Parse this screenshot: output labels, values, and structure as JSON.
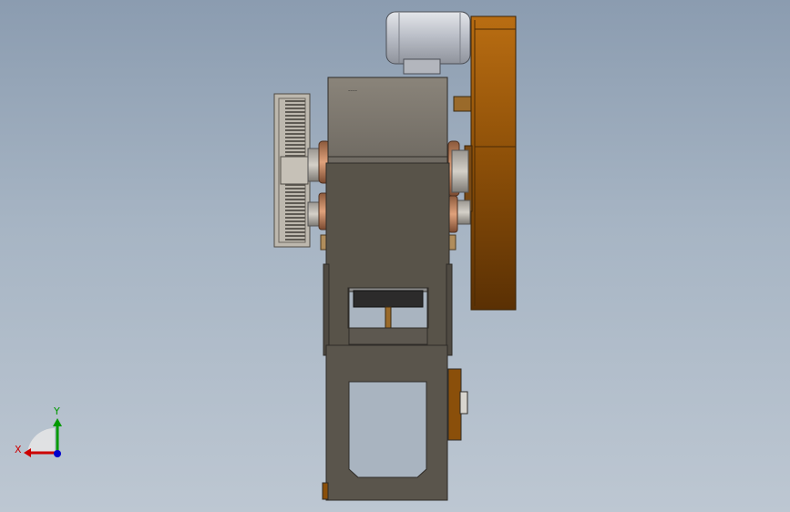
{
  "viewport": {
    "background_top": "#8b9cb0",
    "background_bottom": "#bdc7d2"
  },
  "model": {
    "nameplate_text": "––––",
    "colors": {
      "frame_dark": "#555049",
      "frame_light": "#7d776e",
      "flywheel": "#8a4f0a",
      "motor": "#c8cbd2",
      "gear": "#a9a49a",
      "die": "#2c2b2b"
    }
  },
  "triad": {
    "x_label": "X",
    "y_label": "Y",
    "x_color": "#cc0000",
    "y_color": "#009900",
    "z_color": "#0000cc"
  }
}
